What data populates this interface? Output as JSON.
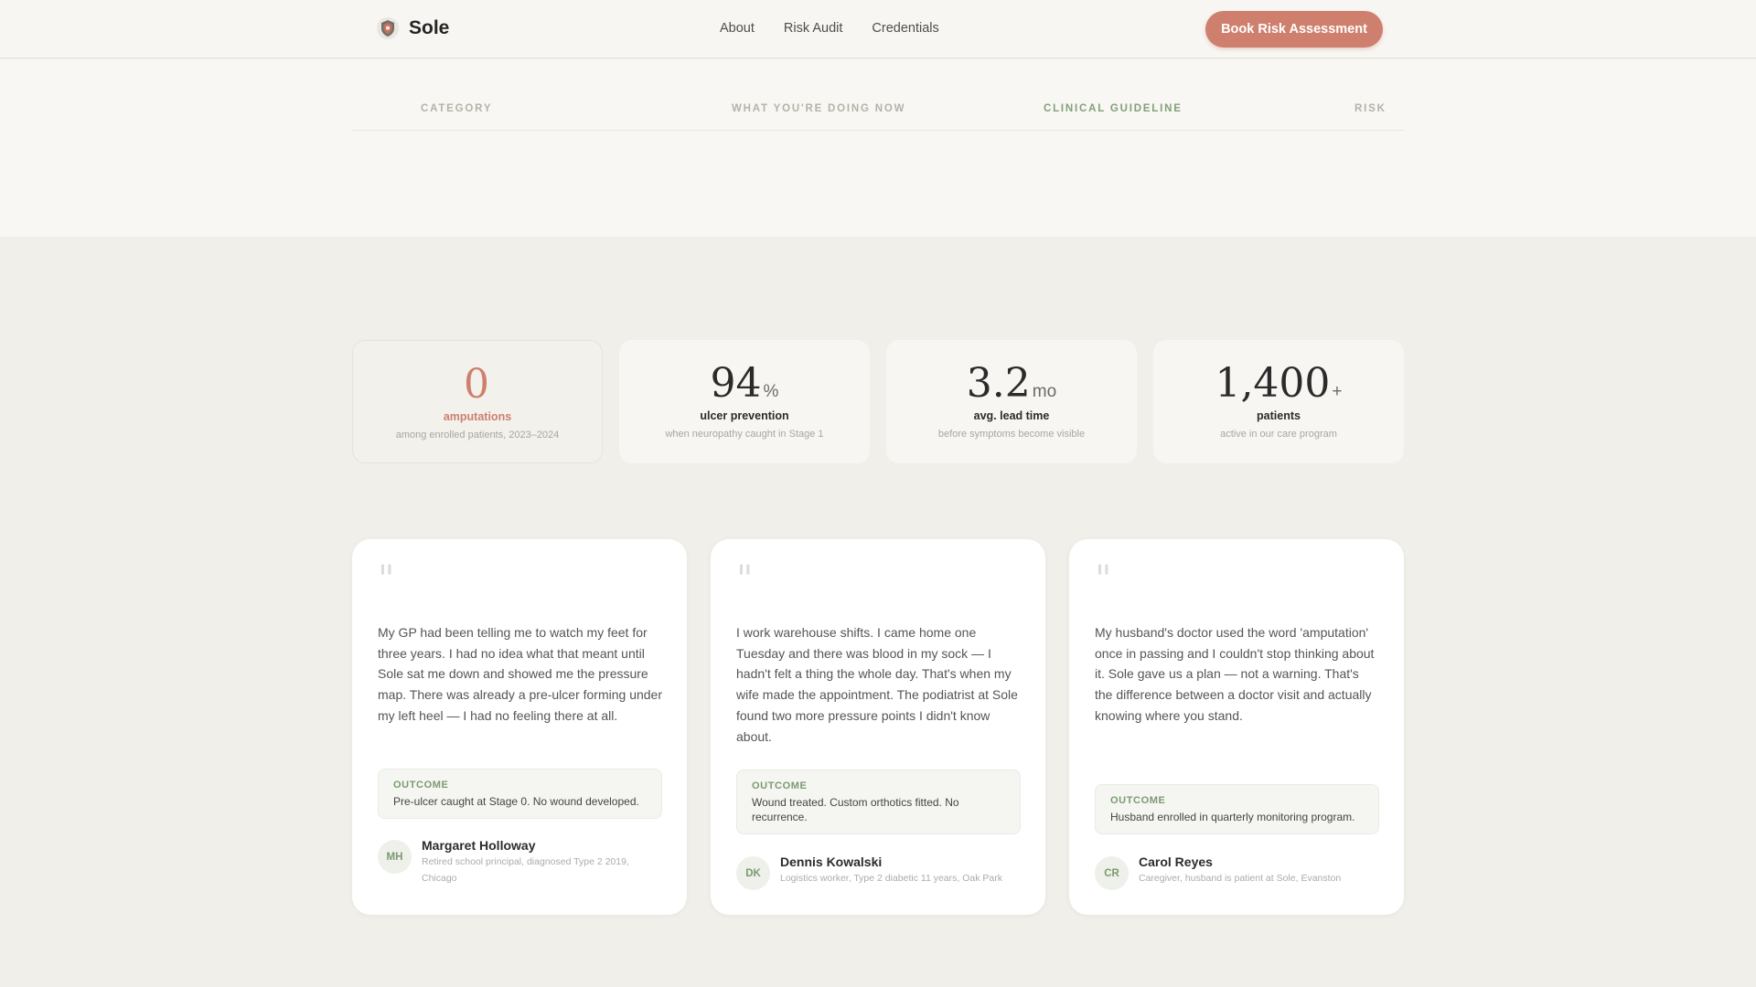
{
  "header": {
    "brand": "Sole",
    "nav": [
      "About",
      "Risk Audit",
      "Credentials"
    ],
    "cta": "Book Risk Assessment"
  },
  "comparison": {
    "columns": [
      "CATEGORY",
      "WHAT YOU'RE DOING NOW",
      "CLINICAL GUIDELINE",
      "RISK"
    ]
  },
  "stats": [
    {
      "value": "0",
      "unit": "",
      "label": "amputations",
      "sub": "among enrolled patients, 2023–2024"
    },
    {
      "value": "94",
      "unit": "%",
      "label": "ulcer prevention",
      "sub": "when neuropathy caught in Stage 1"
    },
    {
      "value": "3.2",
      "unit": "mo",
      "label": "avg. lead time",
      "sub": "before symptoms become visible"
    },
    {
      "value": "1,400",
      "unit": "+",
      "label": "patients",
      "sub": "active in our care program"
    }
  ],
  "testimonials": [
    {
      "quote": "My GP had been telling me to watch my feet for three years. I had no idea what that meant until Sole sat me down and showed me the pressure map. There was already a pre-ulcer forming under my left heel — I had no feeling there at all.",
      "outcome_label": "OUTCOME",
      "outcome": "Pre-ulcer caught at Stage 0. No wound developed.",
      "initials": "MH",
      "name": "Margaret Holloway",
      "desc": "Retired school principal, diagnosed Type 2 2019, Chicago"
    },
    {
      "quote": "I work warehouse shifts. I came home one Tuesday and there was blood in my sock — I hadn't felt a thing the whole day. That's when my wife made the appointment. The podiatrist at Sole found two more pressure points I didn't know about.",
      "outcome_label": "OUTCOME",
      "outcome": "Wound treated. Custom orthotics fitted. No recurrence.",
      "initials": "DK",
      "name": "Dennis Kowalski",
      "desc": "Logistics worker, Type 2 diabetic 11 years, Oak Park"
    },
    {
      "quote": "My husband's doctor used the word 'amputation' once in passing and I couldn't stop thinking about it. Sole gave us a plan — not a warning. That's the difference between a doctor visit and actually knowing where you stand.",
      "outcome_label": "OUTCOME",
      "outcome": "Husband enrolled in quarterly monitoring program.",
      "initials": "CR",
      "name": "Carol Reyes",
      "desc": "Caregiver, husband is patient at Sole, Evanston"
    }
  ]
}
